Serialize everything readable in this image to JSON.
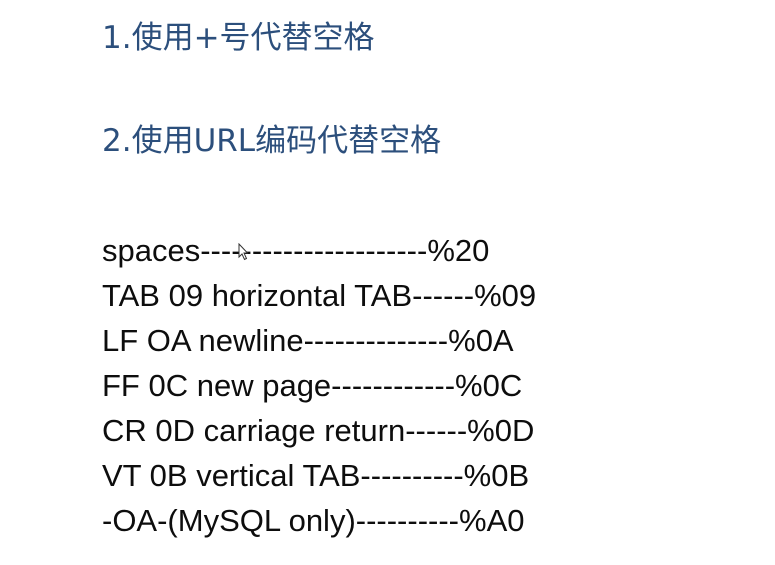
{
  "headings": [
    "1.使用+号代替空格",
    "2.使用URL编码代替空格"
  ],
  "encodings": [
    "spaces----------------------%20",
    "TAB 09 horizontal TAB------%09",
    "LF OA newline--------------%0A",
    "FF 0C new page------------%0C",
    "CR 0D carriage return------%0D",
    "VT 0B vertical TAB----------%0B",
    "-OA-(MySQL only)----------%A0"
  ],
  "colors": {
    "heading": "#2c4f7c",
    "body_text": "#0d0d0d",
    "background": "#ffffff"
  },
  "cursor_icon": "mouse-pointer-icon"
}
